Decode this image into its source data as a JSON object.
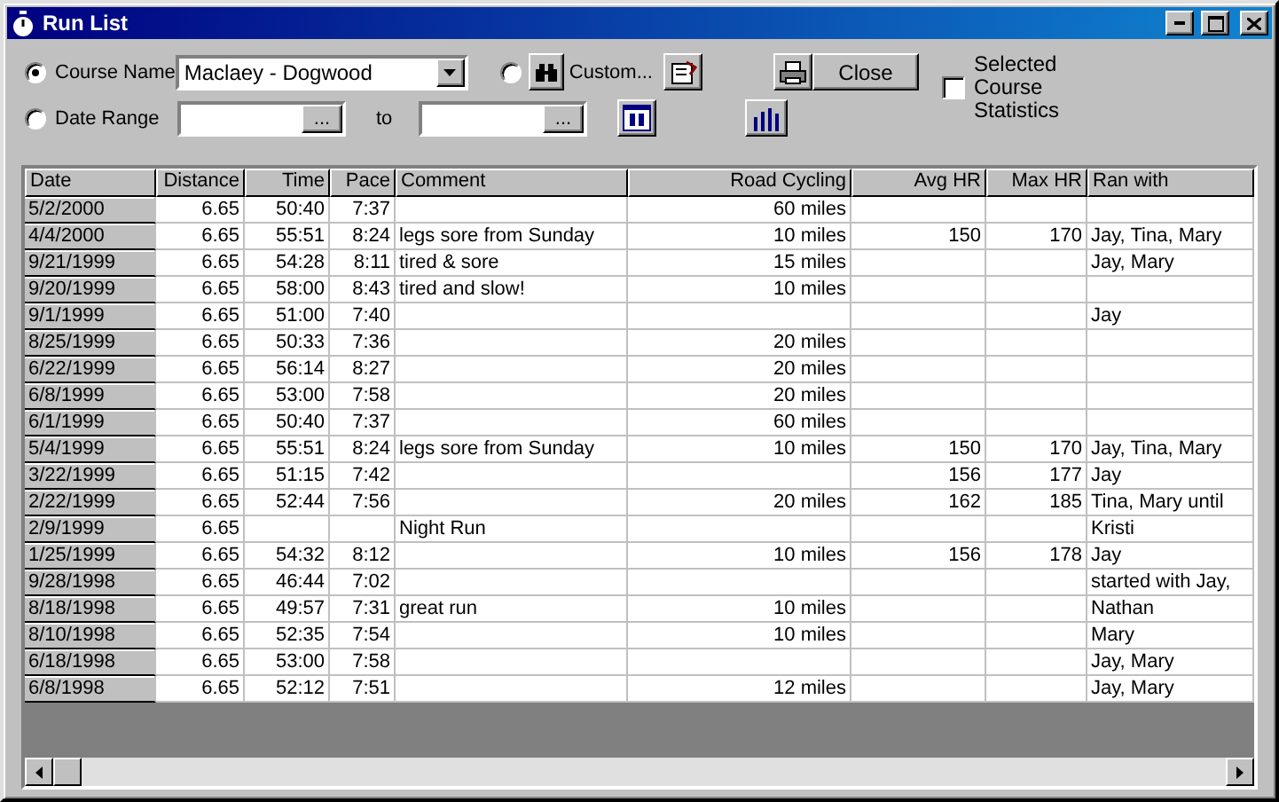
{
  "window": {
    "title": "Run List"
  },
  "filter": {
    "course_option": {
      "label": "Course Name",
      "selected": true
    },
    "course_select": {
      "value": "Maclaey - Dogwood"
    },
    "date_option": {
      "label": "Date Range",
      "selected": false
    },
    "date_from": {
      "button": "..."
    },
    "to_label": "to",
    "date_to": {
      "button": "..."
    },
    "custom_option": {
      "label": "Custom...",
      "selected": false
    },
    "close_button": "Close",
    "stats_checkbox": {
      "label": "Selected Course Statistics",
      "checked": false
    }
  },
  "table": {
    "columns": [
      "Date",
      "Distance",
      "Time",
      "Pace",
      "Comment",
      "Road Cycling",
      "Avg HR",
      "Max HR",
      "Ran with"
    ],
    "rows": [
      [
        "5/2/2000",
        "6.65",
        "50:40",
        "7:37",
        null,
        "60 miles",
        null,
        null,
        null
      ],
      [
        "4/4/2000",
        "6.65",
        "55:51",
        "8:24",
        "legs sore from Sunday",
        "10 miles",
        "150",
        "170",
        "Jay, Tina, Mary"
      ],
      [
        "9/21/1999",
        "6.65",
        "54:28",
        "8:11",
        "tired & sore",
        "15 miles",
        null,
        null,
        "Jay, Mary"
      ],
      [
        "9/20/1999",
        "6.65",
        "58:00",
        "8:43",
        "tired and slow!",
        "10 miles",
        null,
        null,
        null
      ],
      [
        "9/1/1999",
        "6.65",
        "51:00",
        "7:40",
        null,
        null,
        null,
        null,
        "Jay"
      ],
      [
        "8/25/1999",
        "6.65",
        "50:33",
        "7:36",
        null,
        "20 miles",
        null,
        null,
        null
      ],
      [
        "6/22/1999",
        "6.65",
        "56:14",
        "8:27",
        null,
        "20 miles",
        null,
        null,
        null
      ],
      [
        "6/8/1999",
        "6.65",
        "53:00",
        "7:58",
        null,
        "20 miles",
        null,
        null,
        null
      ],
      [
        "6/1/1999",
        "6.65",
        "50:40",
        "7:37",
        null,
        "60 miles",
        null,
        null,
        null
      ],
      [
        "5/4/1999",
        "6.65",
        "55:51",
        "8:24",
        "legs sore from Sunday",
        "10 miles",
        "150",
        "170",
        "Jay, Tina, Mary"
      ],
      [
        "3/22/1999",
        "6.65",
        "51:15",
        "7:42",
        null,
        null,
        "156",
        "177",
        "Jay"
      ],
      [
        "2/22/1999",
        "6.65",
        "52:44",
        "7:56",
        null,
        "20 miles",
        "162",
        "185",
        "Tina, Mary until"
      ],
      [
        "2/9/1999",
        "6.65",
        null,
        null,
        "Night Run",
        null,
        null,
        null,
        "Kristi"
      ],
      [
        "1/25/1999",
        "6.65",
        "54:32",
        "8:12",
        null,
        "10 miles",
        "156",
        "178",
        "Jay"
      ],
      [
        "9/28/1998",
        "6.65",
        "46:44",
        "7:02",
        null,
        null,
        null,
        null,
        "started with Jay,"
      ],
      [
        "8/18/1998",
        "6.65",
        "49:57",
        "7:31",
        "great run",
        "10 miles",
        null,
        null,
        "Nathan"
      ],
      [
        "8/10/1998",
        "6.65",
        "52:35",
        "7:54",
        null,
        "10 miles",
        null,
        null,
        "Mary"
      ],
      [
        "6/18/1998",
        "6.65",
        "53:00",
        "7:58",
        null,
        null,
        null,
        null,
        "Jay, Mary"
      ],
      [
        "6/8/1998",
        "6.65",
        "52:12",
        "7:51",
        null,
        "12 miles",
        null,
        null,
        "Jay, Mary"
      ]
    ]
  }
}
